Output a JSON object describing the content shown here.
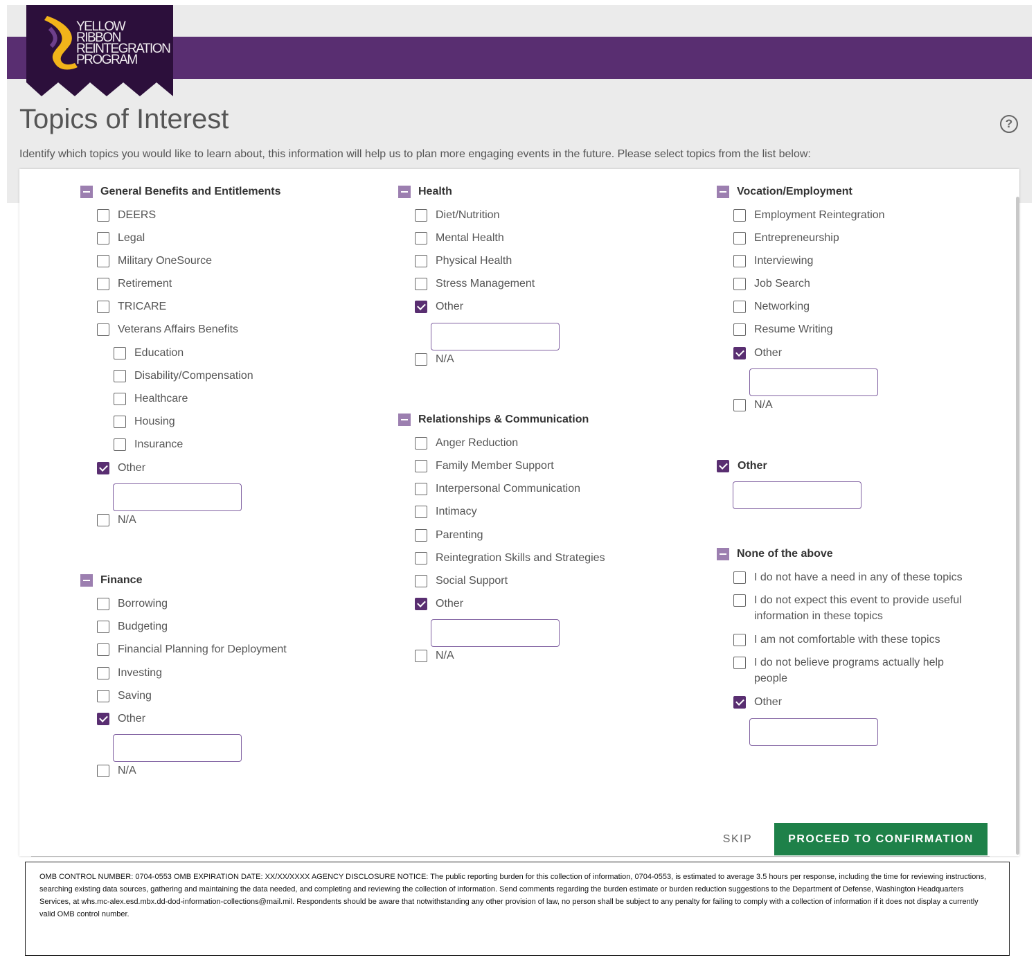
{
  "logo": {
    "text": "YELLOW RIBBON REINTEGRATION PROGRAM",
    "lines": [
      "YELLOW",
      "RIBBON",
      "REINTEGRATION",
      "PROGRAM"
    ]
  },
  "page": {
    "title": "Topics of Interest",
    "intro": "Identify which topics you would like to learn about, this information will help us to plan more engaging events in the future. Please select topics from the list below:"
  },
  "groups": {
    "general": {
      "title": "General Benefits and Entitlements",
      "options": [
        {
          "label": "DEERS",
          "checked": false
        },
        {
          "label": "Legal",
          "checked": false
        },
        {
          "label": "Military OneSource",
          "checked": false
        },
        {
          "label": "Retirement",
          "checked": false
        },
        {
          "label": "TRICARE",
          "checked": false
        },
        {
          "label": "Veterans Affairs Benefits",
          "checked": false
        },
        {
          "label": "Education",
          "checked": false
        },
        {
          "label": "Disability/Compensation",
          "checked": false
        },
        {
          "label": "Healthcare",
          "checked": false
        },
        {
          "label": "Housing",
          "checked": false
        },
        {
          "label": "Insurance",
          "checked": false
        },
        {
          "label": "Other",
          "checked": true
        },
        {
          "label": "N/A",
          "checked": false
        }
      ],
      "other_value": ""
    },
    "finance": {
      "title": "Finance",
      "options": [
        {
          "label": "Borrowing",
          "checked": false
        },
        {
          "label": "Budgeting",
          "checked": false
        },
        {
          "label": "Financial Planning for Deployment",
          "checked": false
        },
        {
          "label": "Investing",
          "checked": false
        },
        {
          "label": "Saving",
          "checked": false
        },
        {
          "label": "Other",
          "checked": true
        },
        {
          "label": "N/A",
          "checked": false
        }
      ],
      "other_value": ""
    },
    "health": {
      "title": "Health",
      "options": [
        {
          "label": "Diet/Nutrition",
          "checked": false
        },
        {
          "label": "Mental Health",
          "checked": false
        },
        {
          "label": "Physical Health",
          "checked": false
        },
        {
          "label": "Stress Management",
          "checked": false
        },
        {
          "label": "Other",
          "checked": true
        },
        {
          "label": "N/A",
          "checked": false
        }
      ],
      "other_value": ""
    },
    "relationships": {
      "title": "Relationships & Communication",
      "options": [
        {
          "label": "Anger Reduction",
          "checked": false
        },
        {
          "label": "Family Member Support",
          "checked": false
        },
        {
          "label": "Interpersonal Communication",
          "checked": false
        },
        {
          "label": "Intimacy",
          "checked": false
        },
        {
          "label": "Parenting",
          "checked": false
        },
        {
          "label": "Reintegration Skills and Strategies",
          "checked": false
        },
        {
          "label": "Social Support",
          "checked": false
        },
        {
          "label": "Other",
          "checked": true
        },
        {
          "label": "N/A",
          "checked": false
        }
      ],
      "other_value": ""
    },
    "vocation": {
      "title": "Vocation/Employment",
      "options": [
        {
          "label": "Employment Reintegration",
          "checked": false
        },
        {
          "label": "Entrepreneurship",
          "checked": false
        },
        {
          "label": "Interviewing",
          "checked": false
        },
        {
          "label": "Job Search",
          "checked": false
        },
        {
          "label": "Networking",
          "checked": false
        },
        {
          "label": "Resume Writing",
          "checked": false
        },
        {
          "label": "Other",
          "checked": true
        },
        {
          "label": "N/A",
          "checked": false
        }
      ],
      "other_value": ""
    },
    "other_top": {
      "label": "Other",
      "checked": true,
      "value": ""
    },
    "none": {
      "title": "None of the above",
      "options": [
        {
          "label": "I do not have a need in any of these topics",
          "checked": false
        },
        {
          "label": "I do not expect this event to provide useful information in these topics",
          "checked": false
        },
        {
          "label": "I am not comfortable with these topics",
          "checked": false
        },
        {
          "label": "I do not believe programs actually help people",
          "checked": false
        },
        {
          "label": "Other",
          "checked": true
        }
      ],
      "other_value": ""
    }
  },
  "actions": {
    "skip": "SKIP",
    "proceed": "PROCEED TO CONFIRMATION"
  },
  "omb_notice": "OMB CONTROL NUMBER:  0704-0553 OMB EXPIRATION DATE: XX/XX/XXXX AGENCY DISCLOSURE NOTICE: The public reporting burden for this collection of information, 0704-0553, is estimated to average 3.5 hours per response, including the time for reviewing instructions, searching existing data sources, gathering and maintaining the data needed, and completing and reviewing the collection of information. Send comments regarding the burden estimate or burden reduction suggestions to the Department of Defense, Washington Headquarters Services, at whs.mc-alex.esd.mbx.dd-dod-information-collections@mail.mil. Respondents should be aware that notwithstanding any other provision of law, no person shall be subject to any penalty for failing to comply with a collection of information if it does not display a currently valid OMB control number.",
  "colors": {
    "brand_purple": "#592e71",
    "accent_yellow": "#f2b41a",
    "proceed_green": "#1e8149",
    "group_marker": "#9c7fb0"
  }
}
